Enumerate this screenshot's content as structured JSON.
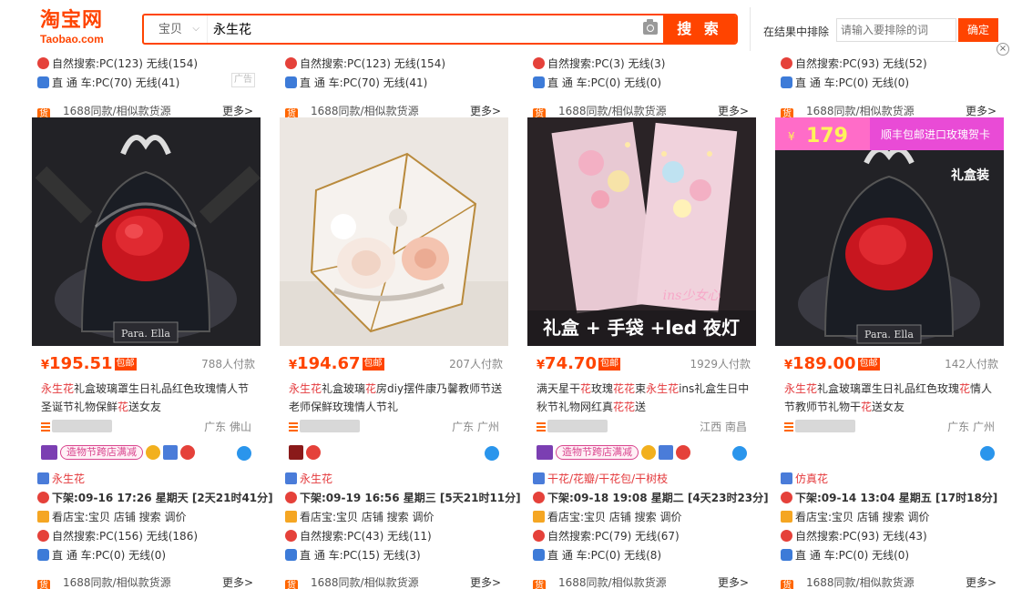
{
  "header": {
    "logo_zh": "淘宝网",
    "logo_en": "Taobao.com",
    "scope_label": "宝贝",
    "search_query": "永生花",
    "search_button": "搜 索",
    "exclude_label": "在结果中排除",
    "exclude_placeholder": "请输入要排除的词",
    "exclude_button": "确定"
  },
  "colors": {
    "accent": "#ff4400",
    "highlight": "#e4393c"
  },
  "top_rows": [
    {
      "natural": "自然搜索:PC(123) 无线(154)",
      "car": "直 通 车:PC(70) 无线(41)",
      "ad": "广告"
    },
    {
      "natural": "自然搜索:PC(123) 无线(154)",
      "car": "直 通 车:PC(70) 无线(41)"
    },
    {
      "natural": "自然搜索:PC(3) 无线(3)",
      "car": "直 通 车:PC(0) 无线(0)"
    },
    {
      "natural": "自然搜索:PC(93) 无线(52)",
      "car": "直 通 车:PC(0) 无线(0)"
    }
  ],
  "bar1688": {
    "icon": "货",
    "text": "1688同款/相似款货源",
    "more": "更多>"
  },
  "products": [
    {
      "price": "195.51",
      "free_ship": "包邮",
      "sales": "788人付款",
      "title_parts": [
        "永生花",
        "礼盒玻璃罩生日礼品红色玫瑰情人节圣诞节礼物保鲜",
        "花",
        "送女友"
      ],
      "location": "广东 佛山",
      "badges": [
        "造物节跨店满减"
      ],
      "category": "永生花",
      "offline": "下架:09-16 17:26 星期天 [2天21时41分]",
      "tools": "看店宝:宝贝 店铺 搜索 调价",
      "natural": "自然搜索:PC(156) 无线(186)",
      "car": "直 通 车:PC(0) 无线(0)",
      "image_colors": [
        "#1b1b1f",
        "#d61f2b"
      ]
    },
    {
      "price": "194.67",
      "free_ship": "包邮",
      "sales": "207人付款",
      "title_parts": [
        "永生花",
        "礼盒玻璃",
        "花",
        "房diy摆件康乃馨教师节送老师保鲜玫瑰情人节礼",
        ""
      ],
      "location": "广东 广州",
      "badges": [],
      "category": "永生花",
      "offline": "下架:09-19 16:56 星期三 [5天21时11分]",
      "tools": "看店宝:宝贝 店铺 搜索 调价",
      "natural": "自然搜索:PC(43) 无线(11)",
      "car": "直 通 车:PC(15) 无线(3)",
      "image_colors": [
        "#efe9e3",
        "#f2c4b2"
      ]
    },
    {
      "price": "74.70",
      "free_ship": "包邮",
      "sales": "1929人付款",
      "title_parts": [
        "满天星干",
        "花",
        "玫瑰",
        "花花",
        "束",
        "永生花",
        "ins礼盒生日中秋节礼物网红真",
        "花花",
        "送"
      ],
      "location": "江西 南昌",
      "badges": [
        "造物节跨店满减"
      ],
      "category": "干花/花瓣/干花包/干树枝",
      "offline": "下架:09-18 19:08 星期二 [4天23时23分]",
      "tools": "看店宝:宝贝 店铺 搜索 调价",
      "natural": "自然搜索:PC(79) 无线(67)",
      "car": "直 通 车:PC(0) 无线(8)",
      "image_overlay": "礼盒 + 手袋 +led 夜灯",
      "image_tag": "ins少女心",
      "image_colors": [
        "#2a2226",
        "#f0c9d8"
      ]
    },
    {
      "price": "189.00",
      "free_ship": "包邮",
      "sales": "142人付款",
      "title_parts": [
        "永生花",
        "礼盒玻璃罩生日礼品红色玫瑰",
        "花",
        "情人节教师节礼物干",
        "花",
        "送女友"
      ],
      "location": "广东 广州",
      "badges": [],
      "category": "仿真花",
      "offline": "下架:09-14 13:04 星期五 [17时18分]",
      "tools": "看店宝:宝贝 店铺 搜索 调价",
      "natural": "自然搜索:PC(93) 无线(43)",
      "car": "直 通 车:PC(0) 无线(0)",
      "promo_price": "179",
      "promo_text": "顺丰包邮进口玫瑰贺卡",
      "image_tag": "礼盒装",
      "image_colors": [
        "#1b1b1f",
        "#d61f2b"
      ]
    }
  ],
  "bottom_bar": {
    "icon": "货",
    "text": "1688同款/相似款货源",
    "more": "更多>"
  }
}
